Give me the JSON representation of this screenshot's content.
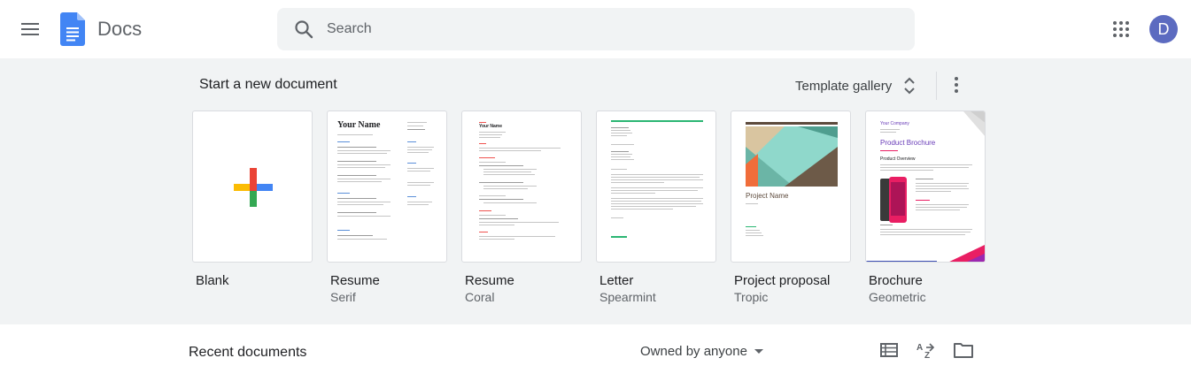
{
  "header": {
    "app_title": "Docs",
    "search_placeholder": "Search",
    "avatar_letter": "D"
  },
  "templates": {
    "section_title": "Start a new document",
    "gallery_label": "Template gallery",
    "items": [
      {
        "name": "Blank",
        "subtitle": ""
      },
      {
        "name": "Resume",
        "subtitle": "Serif",
        "thumb_heading": "Your Name"
      },
      {
        "name": "Resume",
        "subtitle": "Coral",
        "thumb_heading": "Your Name"
      },
      {
        "name": "Letter",
        "subtitle": "Spearmint"
      },
      {
        "name": "Project proposal",
        "subtitle": "Tropic",
        "thumb_heading": "Project Name"
      },
      {
        "name": "Brochure",
        "subtitle": "Geometric",
        "thumb_company": "Your Company",
        "thumb_heading": "Product Brochure",
        "thumb_section": "Product Overview"
      }
    ]
  },
  "recent": {
    "section_title": "Recent documents",
    "owner_filter": "Owned by anyone"
  },
  "colors": {
    "docs_blue": "#4285f4",
    "avatar": "#5c6bc0",
    "plus_blue": "#4285f4",
    "plus_red": "#ea4335",
    "plus_yellow": "#fbbc04",
    "plus_green": "#34a853",
    "spearmint": "#2bb673",
    "tropic_teal": "#8fd8cb",
    "brochure_purple": "#673ab7"
  }
}
